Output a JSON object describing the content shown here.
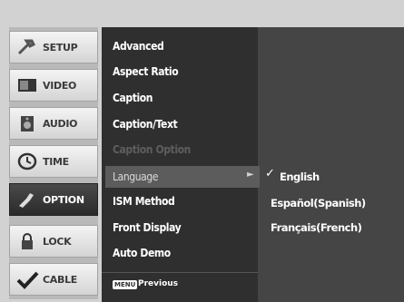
{
  "tabs": [
    {
      "label": "SETUP",
      "icon": "wrench-icon"
    },
    {
      "label": "VIDEO",
      "icon": "monitor-icon"
    },
    {
      "label": "AUDIO",
      "icon": "speaker-icon"
    },
    {
      "label": "TIME",
      "icon": "clock-icon"
    },
    {
      "label": "OPTION",
      "icon": "option-icon",
      "active": true
    },
    {
      "label": "LOCK",
      "icon": "lock-icon"
    },
    {
      "label": "CABLE",
      "icon": "checkmark-icon"
    }
  ],
  "menu": {
    "items": [
      {
        "label": "Advanced"
      },
      {
        "label": "Aspect Ratio"
      },
      {
        "label": "Caption"
      },
      {
        "label": "Caption/Text"
      },
      {
        "label": "Caption Option",
        "disabled": true
      },
      {
        "label": "Language",
        "selected": true
      },
      {
        "label": "ISM Method"
      },
      {
        "label": "Front Display"
      },
      {
        "label": "Auto Demo"
      }
    ],
    "footer": {
      "key_label": "MENU",
      "action_label": "Previous"
    }
  },
  "submenu": {
    "options": [
      {
        "label": "English",
        "checked": true
      },
      {
        "label": "Español(Spanish)"
      },
      {
        "label": "Français(French)"
      }
    ]
  },
  "colors": {
    "panel": "#454545",
    "active_tab": "#2a2a2a"
  }
}
